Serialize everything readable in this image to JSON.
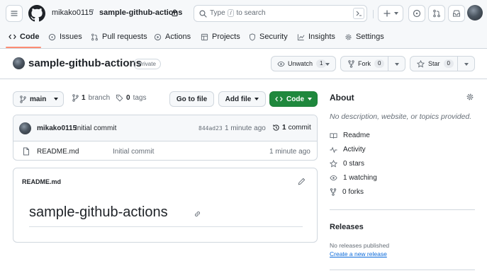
{
  "header": {
    "owner": "mikako0115",
    "separator": "/",
    "repo": "sample-github-actions",
    "search": {
      "prefix": "Type",
      "key": "/",
      "suffix": "to search"
    }
  },
  "nav_tabs": [
    {
      "label": "Code",
      "icon": "code-icon"
    },
    {
      "label": "Issues",
      "icon": "issue-opened-icon"
    },
    {
      "label": "Pull requests",
      "icon": "git-pull-request-icon"
    },
    {
      "label": "Actions",
      "icon": "play-icon"
    },
    {
      "label": "Projects",
      "icon": "table-icon"
    },
    {
      "label": "Security",
      "icon": "shield-icon"
    },
    {
      "label": "Insights",
      "icon": "graph-icon"
    },
    {
      "label": "Settings",
      "icon": "gear-icon"
    }
  ],
  "repo_header": {
    "title": "sample-github-actions",
    "visibility": "Private",
    "watch": {
      "label": "Unwatch",
      "count": "1"
    },
    "fork": {
      "label": "Fork",
      "count": "0"
    },
    "star": {
      "label": "Star",
      "count": "0"
    }
  },
  "toolbar": {
    "branch": "main",
    "branch_count": "1",
    "branch_word": "branch",
    "tag_count": "0",
    "tag_word": "tags",
    "go_to_file": "Go to file",
    "add_file": "Add file",
    "code": "Code"
  },
  "latest_commit": {
    "author": "mikako0115",
    "message": "Initial commit",
    "hash": "844ad23",
    "time": "1 minute ago",
    "commit_count": "1",
    "commit_word": "commit"
  },
  "files": [
    {
      "name": "README.md",
      "message": "Initial commit",
      "time": "1 minute ago"
    }
  ],
  "readme": {
    "filename": "README.md",
    "heading": "sample-github-actions"
  },
  "sidebar": {
    "about_title": "About",
    "description": "No description, website, or topics provided.",
    "items": [
      {
        "label": "Readme",
        "icon": "book-icon"
      },
      {
        "label": "Activity",
        "icon": "pulse-icon"
      },
      {
        "label": "0 stars",
        "icon": "star-icon"
      },
      {
        "label": "1 watching",
        "icon": "eye-icon"
      },
      {
        "label": "0 forks",
        "icon": "repo-forked-icon"
      }
    ],
    "releases_title": "Releases",
    "no_releases": "No releases published",
    "create_release": "Create a new release"
  },
  "colors": {
    "accent_underline": "#fd8c73",
    "code_button": "#1f883d",
    "link": "#0969da",
    "muted": "#656d76",
    "border": "#d0d7de"
  }
}
